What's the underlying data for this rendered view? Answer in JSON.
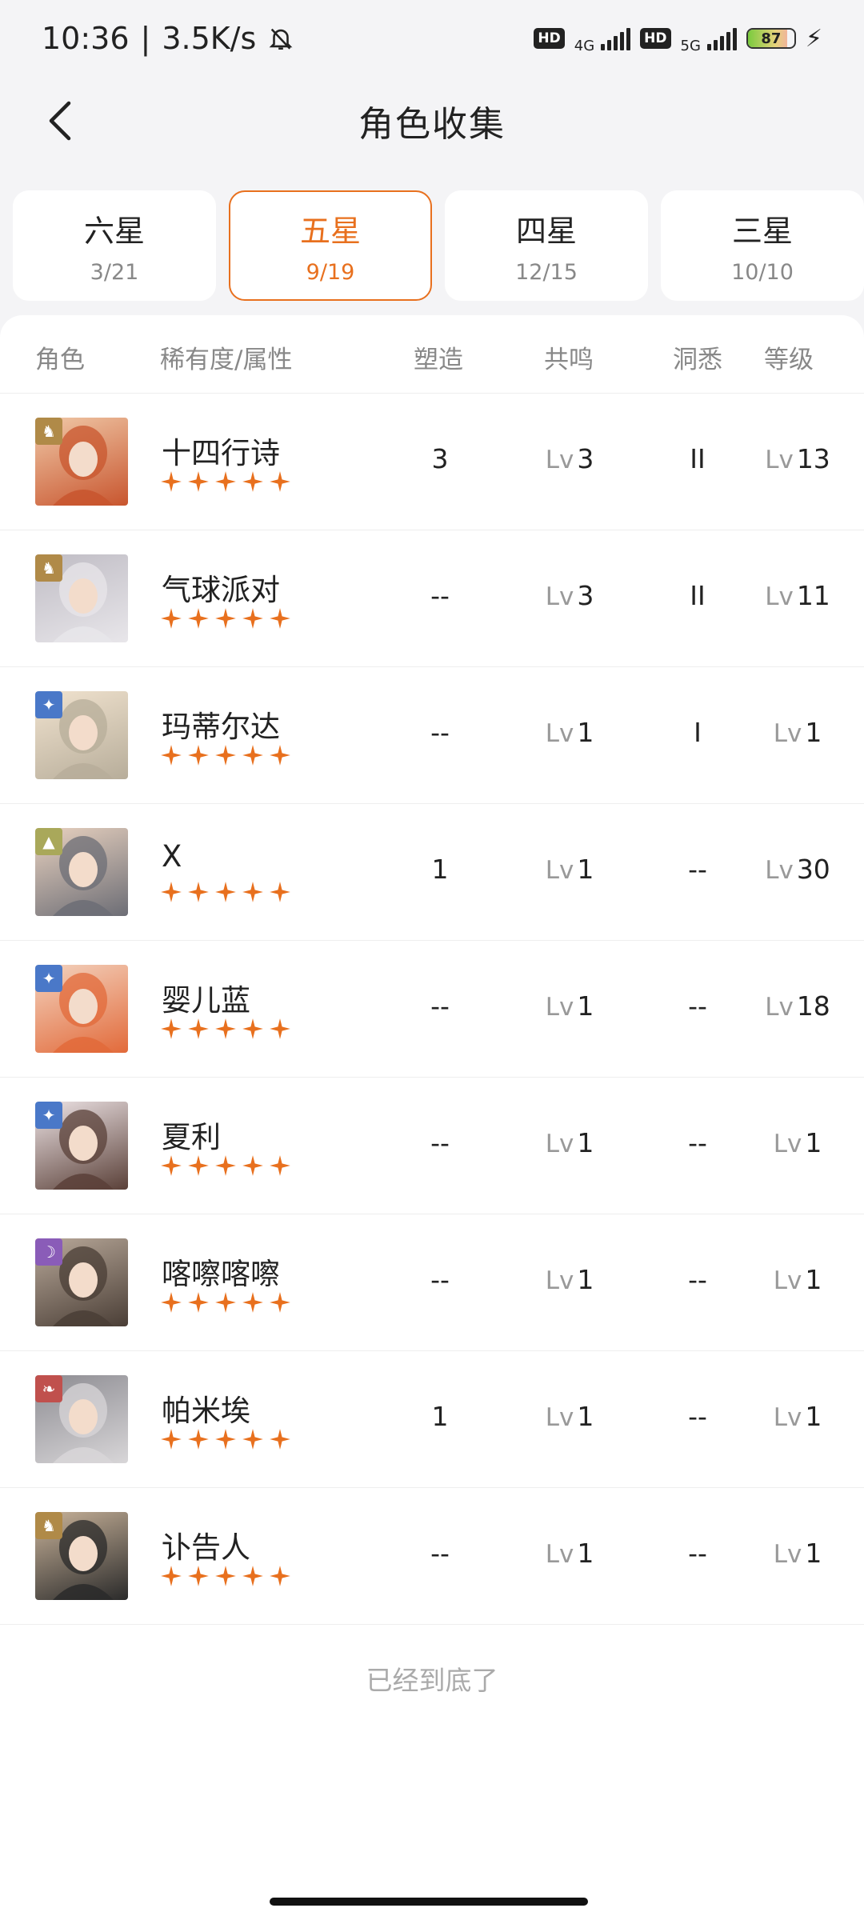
{
  "status_bar": {
    "time": "10:36",
    "net_speed": "3.5K/s",
    "hd1": "HD",
    "net1": "4G",
    "hd2": "HD",
    "net2": "5G",
    "battery": "87"
  },
  "header": {
    "title": "角色收集"
  },
  "tabs": [
    {
      "label": "六星",
      "count": "3/21"
    },
    {
      "label": "五星",
      "count": "9/19"
    },
    {
      "label": "四星",
      "count": "12/15"
    },
    {
      "label": "三星",
      "count": "10/10"
    }
  ],
  "table": {
    "headers": {
      "character": "角色",
      "rarity": "稀有度/属性",
      "shape": "塑造",
      "resonance": "共鸣",
      "insight": "洞悉",
      "level": "等级"
    },
    "lv_prefix": "Lv",
    "rows": [
      {
        "name": "十四行诗",
        "shape": "3",
        "resonance": "3",
        "insight": "II",
        "level": "13",
        "element": "beast-icon",
        "color": "#b08a48"
      },
      {
        "name": "气球派对",
        "shape": "--",
        "resonance": "3",
        "insight": "II",
        "level": "11",
        "element": "beast-icon",
        "color": "#b08a48"
      },
      {
        "name": "玛蒂尔达",
        "shape": "--",
        "resonance": "1",
        "insight": "I",
        "level": "1",
        "element": "star-icon",
        "color": "#4a78c8"
      },
      {
        "name": "X",
        "shape": "1",
        "resonance": "1",
        "insight": "--",
        "level": "30",
        "element": "mineral-icon",
        "color": "#a9a85a"
      },
      {
        "name": "婴儿蓝",
        "shape": "--",
        "resonance": "1",
        "insight": "--",
        "level": "18",
        "element": "star-icon",
        "color": "#4a78c8"
      },
      {
        "name": "夏利",
        "shape": "--",
        "resonance": "1",
        "insight": "--",
        "level": "1",
        "element": "star-icon",
        "color": "#4a78c8"
      },
      {
        "name": "喀嚓喀嚓",
        "shape": "--",
        "resonance": "1",
        "insight": "--",
        "level": "1",
        "element": "moon-icon",
        "color": "#8a5cb8"
      },
      {
        "name": "帕米埃",
        "shape": "1",
        "resonance": "1",
        "insight": "--",
        "level": "1",
        "element": "plant-icon",
        "color": "#c0504d"
      },
      {
        "name": "讣告人",
        "shape": "--",
        "resonance": "1",
        "insight": "--",
        "level": "1",
        "element": "beast-icon",
        "color": "#b08a48"
      }
    ]
  },
  "footer": {
    "end_text": "已经到底了"
  }
}
